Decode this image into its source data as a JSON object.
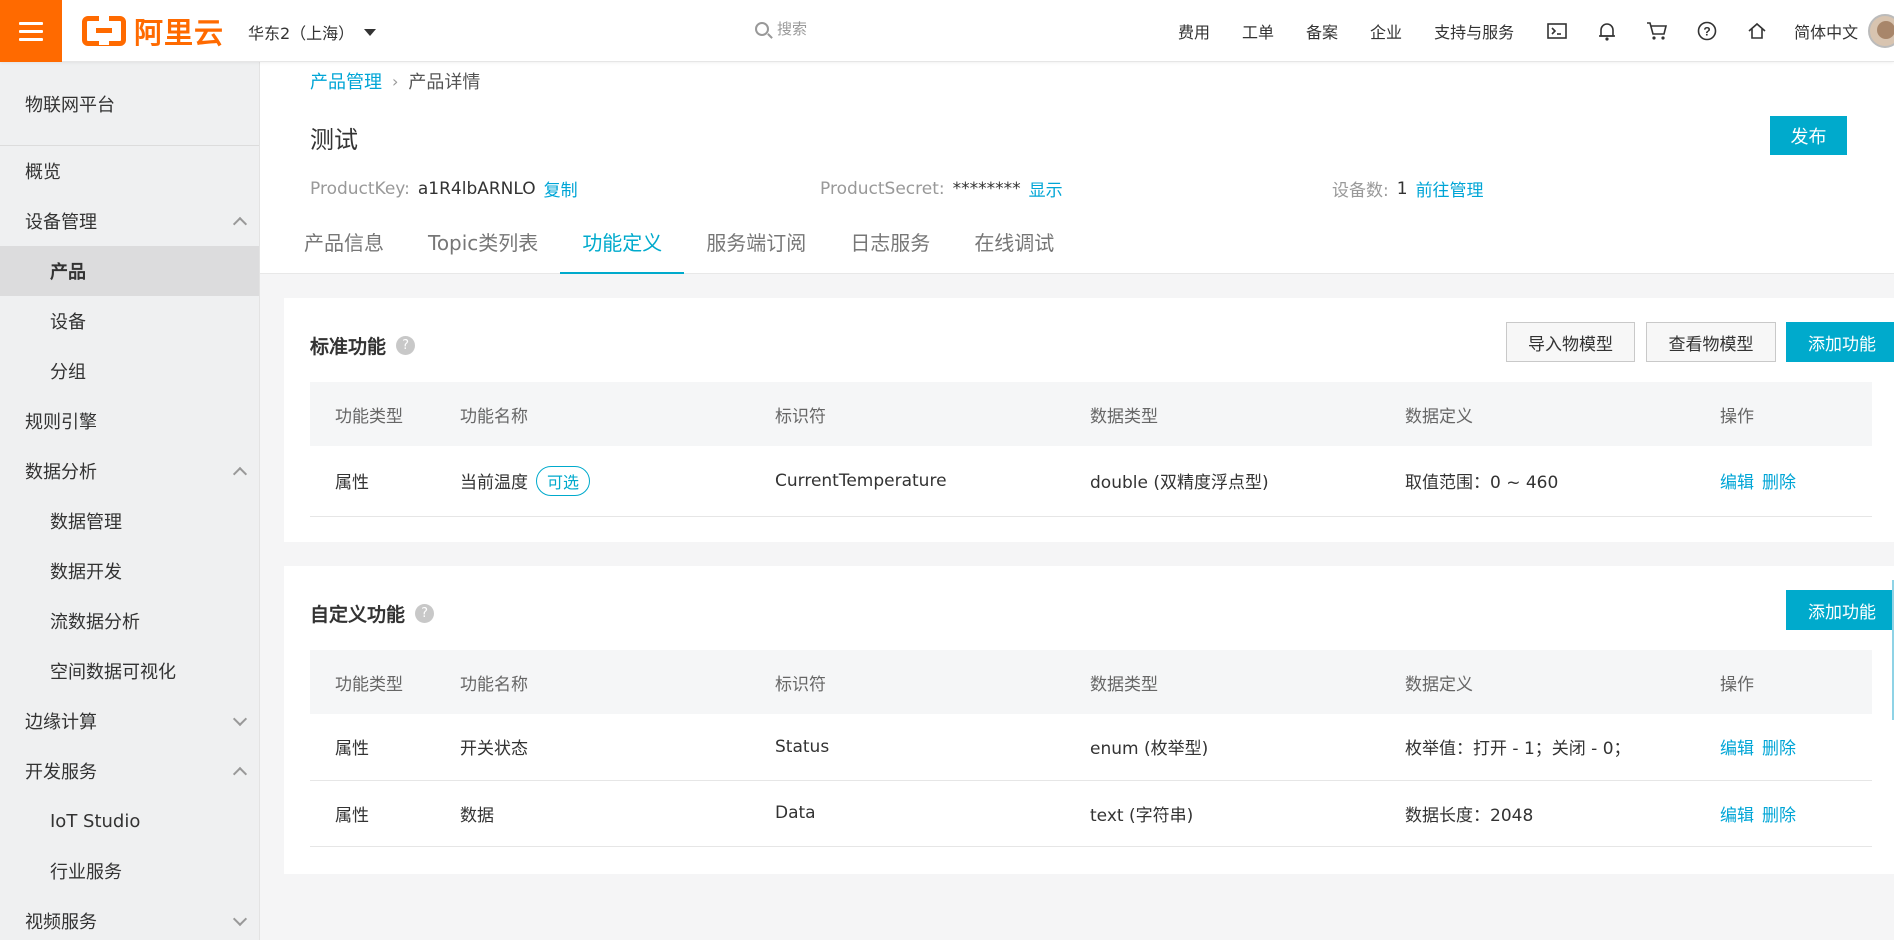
{
  "topbar": {
    "logo_text": "阿里云",
    "region": "华东2（上海）",
    "search_placeholder": "搜索",
    "nav": [
      "费用",
      "工单",
      "备案",
      "企业",
      "支持与服务"
    ],
    "lang": "简体中文",
    "icons": [
      "terminal-icon",
      "bell-icon",
      "cart-icon",
      "help-icon",
      "home-icon"
    ],
    "accent": "#ff6a00"
  },
  "sidebar": {
    "title": "物联网平台",
    "items": [
      {
        "label": "概览",
        "level": 1,
        "chevron": ""
      },
      {
        "label": "设备管理",
        "level": 1,
        "chevron": "up"
      },
      {
        "label": "产品",
        "level": 2,
        "chevron": "",
        "active": true
      },
      {
        "label": "设备",
        "level": 2,
        "chevron": ""
      },
      {
        "label": "分组",
        "level": 2,
        "chevron": ""
      },
      {
        "label": "规则引擎",
        "level": 1,
        "chevron": ""
      },
      {
        "label": "数据分析",
        "level": 1,
        "chevron": "up"
      },
      {
        "label": "数据管理",
        "level": 2,
        "chevron": ""
      },
      {
        "label": "数据开发",
        "level": 2,
        "chevron": ""
      },
      {
        "label": "流数据分析",
        "level": 2,
        "chevron": ""
      },
      {
        "label": "空间数据可视化",
        "level": 2,
        "chevron": ""
      },
      {
        "label": "边缘计算",
        "level": 1,
        "chevron": "down"
      },
      {
        "label": "开发服务",
        "level": 1,
        "chevron": "up"
      },
      {
        "label": "IoT Studio",
        "level": 2,
        "chevron": ""
      },
      {
        "label": "行业服务",
        "level": 2,
        "chevron": ""
      },
      {
        "label": "视频服务",
        "level": 1,
        "chevron": "down"
      }
    ]
  },
  "header": {
    "breadcrumb_link": "产品管理",
    "breadcrumb_sep": "›",
    "breadcrumb_current": "产品详情",
    "title": "测试",
    "publish": "发布",
    "product_key_label": "ProductKey:",
    "product_key": "a1R4lbARNLO",
    "copy": "复制",
    "product_secret_label": "ProductSecret:",
    "product_secret": "********",
    "show": "显示",
    "device_count_label": "设备数:",
    "device_count": "1",
    "manage": "前往管理",
    "tabs": [
      "产品信息",
      "Topic类列表",
      "功能定义",
      "服务端订阅",
      "日志服务",
      "在线调试"
    ],
    "active_tab": 2
  },
  "standard": {
    "title": "标准功能",
    "help": "?",
    "btn_import": "导入物模型",
    "btn_view": "查看物模型",
    "btn_add": "添加功能",
    "columns": [
      "功能类型",
      "功能名称",
      "标识符",
      "数据类型",
      "数据定义",
      "操作"
    ],
    "rows": [
      {
        "type": "属性",
        "name": "当前温度",
        "tag": "可选",
        "id": "CurrentTemperature",
        "dtype": "double (双精度浮点型)",
        "def": "取值范围：0 ~ 460",
        "edit": "编辑",
        "del": "删除"
      }
    ]
  },
  "custom": {
    "title": "自定义功能",
    "help": "?",
    "btn_add": "添加功能",
    "columns": [
      "功能类型",
      "功能名称",
      "标识符",
      "数据类型",
      "数据定义",
      "操作"
    ],
    "rows": [
      {
        "type": "属性",
        "name": "开关状态",
        "id": "Status",
        "dtype": "enum (枚举型)",
        "def": "枚举值：打开 - 1；关闭 - 0；",
        "edit": "编辑",
        "del": "删除"
      },
      {
        "type": "属性",
        "name": "数据",
        "id": "Data",
        "dtype": "text (字符串)",
        "def": "数据长度：2048",
        "edit": "编辑",
        "del": "删除"
      }
    ]
  }
}
